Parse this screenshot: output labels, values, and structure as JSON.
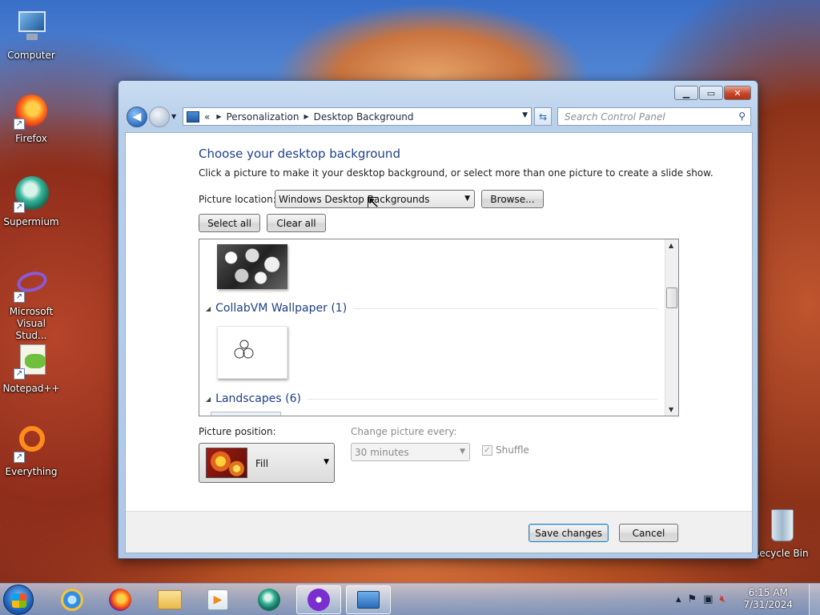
{
  "desktop": {
    "icons": [
      {
        "label": "Computer",
        "icon": "computer-icon"
      },
      {
        "label": "Firefox",
        "icon": "firefox-icon"
      },
      {
        "label": "Supermium",
        "icon": "supermium-icon"
      },
      {
        "label": "Microsoft Visual Stud...",
        "icon": "visual-studio-icon"
      },
      {
        "label": "Notepad++",
        "icon": "notepadpp-icon"
      },
      {
        "label": "Everything",
        "icon": "everything-icon"
      },
      {
        "label": "Recycle Bin",
        "icon": "recycle-bin-icon"
      }
    ]
  },
  "window": {
    "breadcrumb": [
      "Personalization",
      "Desktop Background"
    ],
    "breadcrumb_prefix": "«",
    "search_placeholder": "Search Control Panel",
    "heading": "Choose your desktop background",
    "description": "Click a picture to make it your desktop background, or select more than one picture to create a slide show.",
    "picture_location_label": "Picture location:",
    "picture_location_value": "Windows Desktop Backgrounds",
    "browse_label": "Browse...",
    "select_all_label": "Select all",
    "clear_all_label": "Clear all",
    "groups": [
      {
        "name": "CollabVM Wallpaper (1)"
      },
      {
        "name": "Landscapes (6)"
      }
    ],
    "picture_position_label": "Picture position:",
    "picture_position_value": "Fill",
    "change_picture_label": "Change picture every:",
    "change_picture_value": "30 minutes",
    "shuffle_label": "Shuffle",
    "save_label": "Save changes",
    "cancel_label": "Cancel"
  },
  "taskbar": {
    "time": "6:15 AM",
    "date": "7/31/2024"
  },
  "colors": {
    "heading": "#1e3f87",
    "taskbar": "#96b9e1"
  }
}
